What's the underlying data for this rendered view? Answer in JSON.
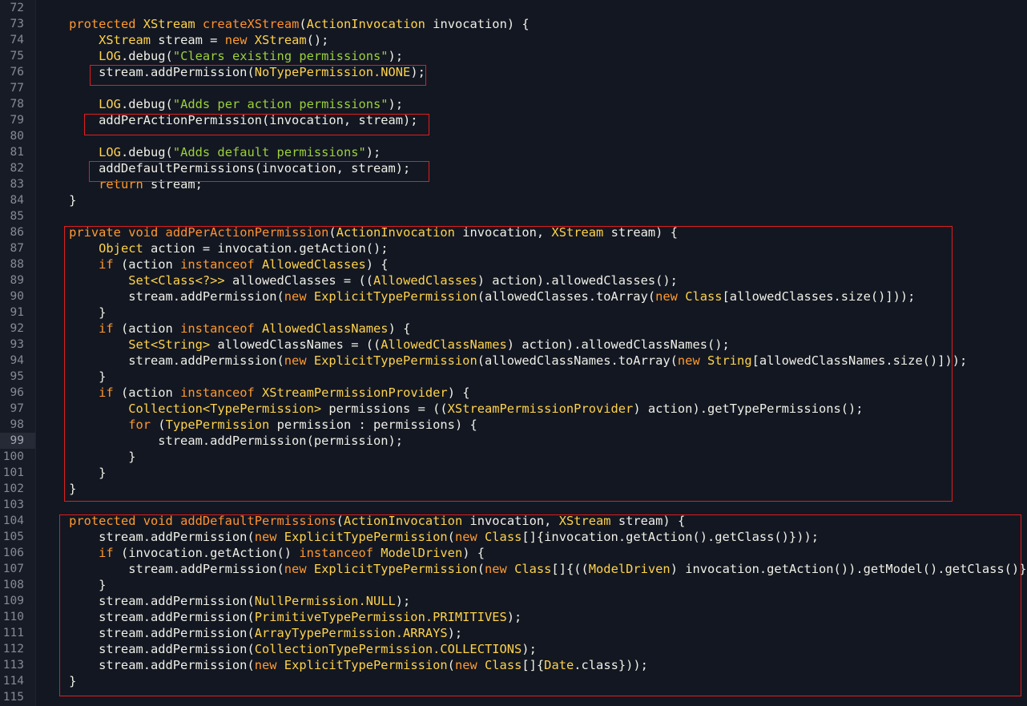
{
  "editor": {
    "lines": [
      {
        "n": "72",
        "t": []
      },
      {
        "n": "73",
        "t": [
          [
            "pl",
            "    "
          ],
          [
            "kw",
            "protected "
          ],
          [
            "ty",
            "XStream "
          ],
          [
            "fn",
            "createXStream"
          ],
          [
            "pl",
            "("
          ],
          [
            "ty",
            "ActionInvocation"
          ],
          [
            "pl",
            " invocation) {"
          ]
        ]
      },
      {
        "n": "74",
        "t": [
          [
            "pl",
            "        "
          ],
          [
            "ty",
            "XStream"
          ],
          [
            "pl",
            " stream = "
          ],
          [
            "kw",
            "new "
          ],
          [
            "ty",
            "XStream"
          ],
          [
            "pl",
            "();"
          ]
        ]
      },
      {
        "n": "75",
        "t": [
          [
            "pl",
            "        "
          ],
          [
            "ty",
            "LOG"
          ],
          [
            "pl",
            ".debug("
          ],
          [
            "st",
            "\"Clears existing permissions\""
          ],
          [
            "pl",
            ");"
          ]
        ]
      },
      {
        "n": "76",
        "t": [
          [
            "pl",
            "        stream.addPermission("
          ],
          [
            "ty",
            "NoTypePermission.NONE"
          ],
          [
            "pl",
            ");"
          ]
        ]
      },
      {
        "n": "77",
        "t": []
      },
      {
        "n": "78",
        "t": [
          [
            "pl",
            "        "
          ],
          [
            "ty",
            "LOG"
          ],
          [
            "pl",
            ".debug("
          ],
          [
            "st",
            "\"Adds per action permissions\""
          ],
          [
            "pl",
            ");"
          ]
        ]
      },
      {
        "n": "79",
        "t": [
          [
            "pl",
            "        addPerActionPermission(invocation, stream);"
          ]
        ]
      },
      {
        "n": "80",
        "t": []
      },
      {
        "n": "81",
        "t": [
          [
            "pl",
            "        "
          ],
          [
            "ty",
            "LOG"
          ],
          [
            "pl",
            ".debug("
          ],
          [
            "st",
            "\"Adds default permissions\""
          ],
          [
            "pl",
            ");"
          ]
        ]
      },
      {
        "n": "82",
        "t": [
          [
            "pl",
            "        addDefaultPermissions(invocation, stream);"
          ]
        ]
      },
      {
        "n": "83",
        "t": [
          [
            "pl",
            "        "
          ],
          [
            "kw",
            "return"
          ],
          [
            "pl",
            " stream;"
          ]
        ]
      },
      {
        "n": "84",
        "t": [
          [
            "pl",
            "    }"
          ]
        ]
      },
      {
        "n": "85",
        "t": []
      },
      {
        "n": "86",
        "t": [
          [
            "pl",
            "    "
          ],
          [
            "kw",
            "private void "
          ],
          [
            "fn",
            "addPerActionPermission"
          ],
          [
            "pl",
            "("
          ],
          [
            "ty",
            "ActionInvocation"
          ],
          [
            "pl",
            " invocation, "
          ],
          [
            "ty",
            "XStream"
          ],
          [
            "pl",
            " stream) {"
          ]
        ]
      },
      {
        "n": "87",
        "t": [
          [
            "pl",
            "        "
          ],
          [
            "ty",
            "Object"
          ],
          [
            "pl",
            " action = invocation.getAction();"
          ]
        ]
      },
      {
        "n": "88",
        "t": [
          [
            "pl",
            "        "
          ],
          [
            "kw",
            "if"
          ],
          [
            "pl",
            " (action "
          ],
          [
            "kw",
            "instanceof "
          ],
          [
            "ty",
            "AllowedClasses"
          ],
          [
            "pl",
            ") {"
          ]
        ]
      },
      {
        "n": "89",
        "t": [
          [
            "pl",
            "            "
          ],
          [
            "ty",
            "Set<Class<?>>"
          ],
          [
            "pl",
            " allowedClasses = (("
          ],
          [
            "ty",
            "AllowedClasses"
          ],
          [
            "pl",
            ") action).allowedClasses();"
          ]
        ]
      },
      {
        "n": "90",
        "t": [
          [
            "pl",
            "            stream.addPermission("
          ],
          [
            "kw",
            "new "
          ],
          [
            "ty",
            "ExplicitTypePermission"
          ],
          [
            "pl",
            "(allowedClasses.toArray("
          ],
          [
            "kw",
            "new "
          ],
          [
            "ty",
            "Class"
          ],
          [
            "pl",
            "[allowedClasses.size()]));"
          ]
        ]
      },
      {
        "n": "91",
        "t": [
          [
            "pl",
            "        }"
          ]
        ]
      },
      {
        "n": "92",
        "t": [
          [
            "pl",
            "        "
          ],
          [
            "kw",
            "if"
          ],
          [
            "pl",
            " (action "
          ],
          [
            "kw",
            "instanceof "
          ],
          [
            "ty",
            "AllowedClassNames"
          ],
          [
            "pl",
            ") {"
          ]
        ]
      },
      {
        "n": "93",
        "t": [
          [
            "pl",
            "            "
          ],
          [
            "ty",
            "Set<String>"
          ],
          [
            "pl",
            " allowedClassNames = (("
          ],
          [
            "ty",
            "AllowedClassNames"
          ],
          [
            "pl",
            ") action).allowedClassNames();"
          ]
        ]
      },
      {
        "n": "94",
        "t": [
          [
            "pl",
            "            stream.addPermission("
          ],
          [
            "kw",
            "new "
          ],
          [
            "ty",
            "ExplicitTypePermission"
          ],
          [
            "pl",
            "(allowedClassNames.toArray("
          ],
          [
            "kw",
            "new "
          ],
          [
            "ty",
            "String"
          ],
          [
            "pl",
            "[allowedClassNames.size()]));"
          ]
        ]
      },
      {
        "n": "95",
        "t": [
          [
            "pl",
            "        }"
          ]
        ]
      },
      {
        "n": "96",
        "t": [
          [
            "pl",
            "        "
          ],
          [
            "kw",
            "if"
          ],
          [
            "pl",
            " (action "
          ],
          [
            "kw",
            "instanceof "
          ],
          [
            "ty",
            "XStreamPermissionProvider"
          ],
          [
            "pl",
            ") {"
          ]
        ]
      },
      {
        "n": "97",
        "t": [
          [
            "pl",
            "            "
          ],
          [
            "ty",
            "Collection<TypePermission>"
          ],
          [
            "pl",
            " permissions = (("
          ],
          [
            "ty",
            "XStreamPermissionProvider"
          ],
          [
            "pl",
            ") action).getTypePermissions();"
          ]
        ]
      },
      {
        "n": "98",
        "t": [
          [
            "pl",
            "            "
          ],
          [
            "kw",
            "for"
          ],
          [
            "pl",
            " ("
          ],
          [
            "ty",
            "TypePermission"
          ],
          [
            "pl",
            " permission : permissions) {"
          ]
        ]
      },
      {
        "n": "99",
        "t": [
          [
            "pl",
            "                stream.addPermission(permission);"
          ]
        ]
      },
      {
        "n": "100",
        "t": [
          [
            "pl",
            "            }"
          ]
        ]
      },
      {
        "n": "101",
        "t": [
          [
            "pl",
            "        }"
          ]
        ]
      },
      {
        "n": "102",
        "t": [
          [
            "pl",
            "    }"
          ]
        ]
      },
      {
        "n": "103",
        "t": []
      },
      {
        "n": "104",
        "t": [
          [
            "pl",
            "    "
          ],
          [
            "kw",
            "protected void "
          ],
          [
            "fn",
            "addDefaultPermissions"
          ],
          [
            "pl",
            "("
          ],
          [
            "ty",
            "ActionInvocation"
          ],
          [
            "pl",
            " invocation, "
          ],
          [
            "ty",
            "XStream"
          ],
          [
            "pl",
            " stream) {"
          ]
        ]
      },
      {
        "n": "105",
        "t": [
          [
            "pl",
            "        stream.addPermission("
          ],
          [
            "kw",
            "new "
          ],
          [
            "ty",
            "ExplicitTypePermission"
          ],
          [
            "pl",
            "("
          ],
          [
            "kw",
            "new "
          ],
          [
            "ty",
            "Class"
          ],
          [
            "pl",
            "[]{invocation.getAction().getClass()}));"
          ]
        ]
      },
      {
        "n": "106",
        "t": [
          [
            "pl",
            "        "
          ],
          [
            "kw",
            "if"
          ],
          [
            "pl",
            " (invocation.getAction() "
          ],
          [
            "kw",
            "instanceof "
          ],
          [
            "ty",
            "ModelDriven"
          ],
          [
            "pl",
            ") {"
          ]
        ]
      },
      {
        "n": "107",
        "t": [
          [
            "pl",
            "            stream.addPermission("
          ],
          [
            "kw",
            "new "
          ],
          [
            "ty",
            "ExplicitTypePermission"
          ],
          [
            "pl",
            "("
          ],
          [
            "kw",
            "new "
          ],
          [
            "ty",
            "Class"
          ],
          [
            "pl",
            "[]{(("
          ],
          [
            "ty",
            "ModelDriven"
          ],
          [
            "pl",
            ") invocation.getAction()).getModel().getClass()}));"
          ]
        ]
      },
      {
        "n": "108",
        "t": [
          [
            "pl",
            "        }"
          ]
        ]
      },
      {
        "n": "109",
        "t": [
          [
            "pl",
            "        stream.addPermission("
          ],
          [
            "ty",
            "NullPermission.NULL"
          ],
          [
            "pl",
            ");"
          ]
        ]
      },
      {
        "n": "110",
        "t": [
          [
            "pl",
            "        stream.addPermission("
          ],
          [
            "ty",
            "PrimitiveTypePermission.PRIMITIVES"
          ],
          [
            "pl",
            ");"
          ]
        ]
      },
      {
        "n": "111",
        "t": [
          [
            "pl",
            "        stream.addPermission("
          ],
          [
            "ty",
            "ArrayTypePermission.ARRAYS"
          ],
          [
            "pl",
            ");"
          ]
        ]
      },
      {
        "n": "112",
        "t": [
          [
            "pl",
            "        stream.addPermission("
          ],
          [
            "ty",
            "CollectionTypePermission.COLLECTIONS"
          ],
          [
            "pl",
            ");"
          ]
        ]
      },
      {
        "n": "113",
        "t": [
          [
            "pl",
            "        stream.addPermission("
          ],
          [
            "kw",
            "new "
          ],
          [
            "ty",
            "ExplicitTypePermission"
          ],
          [
            "pl",
            "("
          ],
          [
            "kw",
            "new "
          ],
          [
            "ty",
            "Class"
          ],
          [
            "pl",
            "[]{"
          ],
          [
            "ty",
            "Date"
          ],
          [
            "pl",
            ".class}));"
          ]
        ]
      },
      {
        "n": "114",
        "t": [
          [
            "pl",
            "    }"
          ]
        ]
      },
      {
        "n": "115",
        "t": []
      }
    ],
    "current_line": "99"
  },
  "colors": {
    "background": "#131722",
    "keyword": "#ff9a2e",
    "type": "#ffd34a",
    "method": "#ff9130",
    "string": "#9bd13a",
    "plain": "#f0f0e6",
    "highlight_box": "#e01e1e"
  }
}
